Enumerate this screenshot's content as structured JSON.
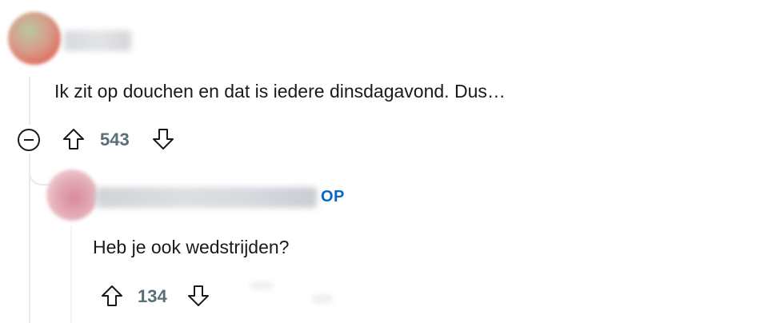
{
  "comments": [
    {
      "text": "Ik zit op douchen en dat is iedere dinsdagavond. Dus…",
      "votes": "543"
    },
    {
      "badge": "OP",
      "text": "Heb je ook wedstrijden?",
      "votes": "134"
    }
  ],
  "icons": {
    "collapse": "minus-circle-icon",
    "upvote": "arrow-up-icon",
    "downvote": "arrow-down-icon"
  },
  "colors": {
    "op_badge": "#0a64c8",
    "vote_count": "#576f76",
    "thread_line": "#e5ebee"
  }
}
